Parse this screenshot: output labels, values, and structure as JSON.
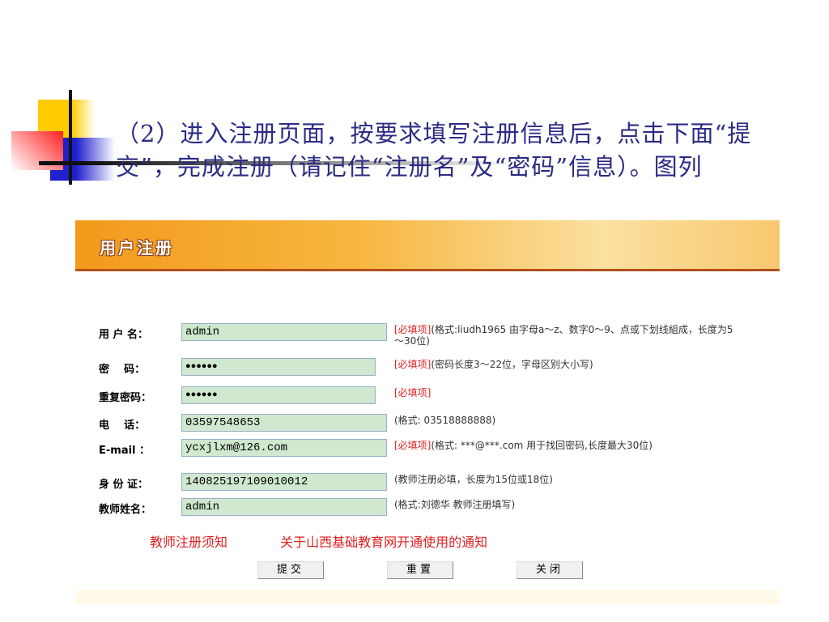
{
  "title": "（2）进入注册页面，按要求填写注册信息后，点击下面“提交”，完成注册（请记住“注册名”及“密码”信息）。图列",
  "banner": {
    "title": "用户注册"
  },
  "form": [
    {
      "label": "用 户 名：",
      "value": "admin",
      "required": "[必填项]",
      "note": "(格式:liudh1965 由字母a～z、数字0～9、点或下划线組成，长度为5～30位)"
    },
    {
      "label": "密    码：",
      "value": "●●●●●●",
      "required": "[必填项]",
      "note": "(密码长度3～22位，字母区别大小写)"
    },
    {
      "label": "重复密码：",
      "value": "●●●●●●",
      "required": "[必填项]",
      "note": ""
    },
    {
      "label": "电    话：",
      "value": "03597548653",
      "required": "",
      "note": "(格式: 03518888888)"
    },
    {
      "label": "E-mail ：",
      "value": "ycxjlxm@126.com",
      "required": "[必填项]",
      "note": "(格式: ***@***.com 用于找回密码,长度最大30位)"
    },
    {
      "label": "身 份 证：",
      "value": "140825197109010012",
      "required": "",
      "note": "(教师注册必填，长度为15位或18位)"
    },
    {
      "label": "教师姓名：",
      "value": "admin",
      "required": "",
      "note": "(格式:刘德华 教师注册填写)"
    }
  ],
  "links": [
    "教师注册须知",
    "关于山西基础教育网开通使用的通知"
  ],
  "buttons": {
    "submit": "提交",
    "reset": "重置",
    "close": "关闭"
  }
}
